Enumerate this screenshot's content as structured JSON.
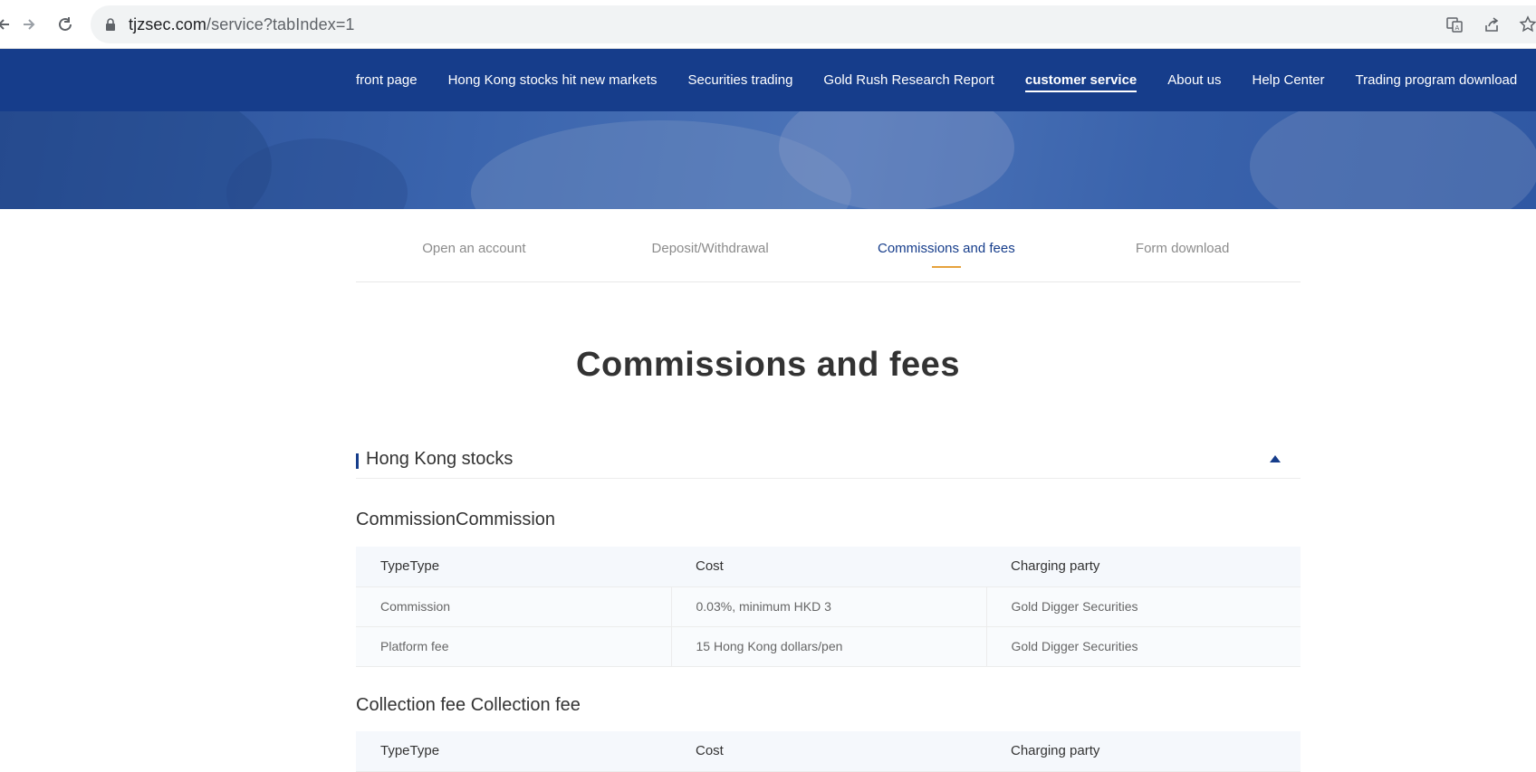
{
  "browser": {
    "url_host": "tjzsec.com",
    "url_path": "/service?tabIndex=1"
  },
  "nav": {
    "items": [
      {
        "label": "front page",
        "active": false
      },
      {
        "label": "Hong Kong stocks hit new markets",
        "active": false
      },
      {
        "label": "Securities trading",
        "active": false
      },
      {
        "label": "Gold Rush Research Report",
        "active": false
      },
      {
        "label": "customer service",
        "active": true
      },
      {
        "label": "About us",
        "active": false
      },
      {
        "label": "Help Center",
        "active": false
      },
      {
        "label": "Trading program download",
        "active": false
      }
    ]
  },
  "subtabs": [
    {
      "label": "Open an account",
      "active": false
    },
    {
      "label": "Deposit/Withdrawal",
      "active": false
    },
    {
      "label": "Commissions and fees",
      "active": true
    },
    {
      "label": "Form download",
      "active": false
    }
  ],
  "page_title": "Commissions and fees",
  "section": {
    "title": "Hong Kong stocks",
    "commission": {
      "title": "CommissionCommission",
      "headers": [
        "TypeType",
        "Cost",
        "Charging party"
      ],
      "rows": [
        [
          "Commission",
          "0.03%, minimum HKD 3",
          "Gold Digger Securities"
        ],
        [
          "Platform fee",
          "15 Hong Kong dollars/pen",
          "Gold Digger Securities"
        ]
      ]
    },
    "collection": {
      "title": "Collection fee Collection fee",
      "headers": [
        "TypeType",
        "Cost",
        "Charging party"
      ]
    }
  },
  "colors": {
    "nav_bg": "#163d8b",
    "tab_active": "#163d8b",
    "tab_underline": "#e6a23c"
  }
}
